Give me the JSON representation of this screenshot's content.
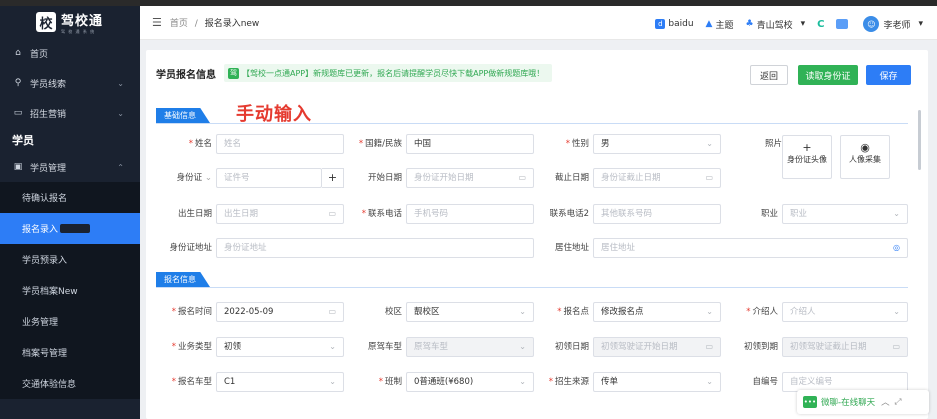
{
  "app": {
    "logo_badge": "校",
    "logo_name": "驾校通",
    "logo_sub": "驾 校 通 系 统"
  },
  "sidebar": {
    "items": [
      {
        "label": "首页",
        "icon": "home-icon",
        "glyph": "⌂"
      },
      {
        "label": "学员线索",
        "icon": "clue-icon",
        "glyph": "⚲",
        "chev": "⌄"
      },
      {
        "label": "招生营销",
        "icon": "marketing-icon",
        "glyph": "▭",
        "chev": "⌄"
      }
    ],
    "group": "学员",
    "group_item": {
      "label": "学员管理",
      "icon": "student-icon",
      "glyph": "▣",
      "chev": "⌃"
    },
    "subitems": [
      "待确认报名",
      "报名录入",
      "学员预录入",
      "学员档案New",
      "业务管理",
      "档案号管理",
      "交通体验信息"
    ]
  },
  "header": {
    "menu_glyph": "☰",
    "breadcrumb_home": "首页",
    "breadcrumb_sep": "/",
    "breadcrumb_current": "报名录入new",
    "baidu": "baidu",
    "theme": "主题",
    "school": "青山驾校",
    "school_chev": "▾",
    "user": "李老师",
    "user_chev": "▾"
  },
  "form": {
    "title": "学员报名信息",
    "notice_badge": "驾",
    "notice": "【驾校一点通APP】新规题库已更新，报名后请提醒学员尽快下载APP做新规题库哦！",
    "back": "返回",
    "read_id": "读取身份证",
    "save": "保存",
    "section_basic": "基础信息",
    "section_enroll": "报名信息",
    "annotation": "手动输入",
    "fields": {
      "name_label": "姓名",
      "name_ph": "姓名",
      "nation_label": "国籍/民族",
      "nation_val": "中国",
      "gender_label": "性别",
      "gender_val": "男",
      "photo_label": "照片",
      "idcard_photo": "身份证头像",
      "face_capture": "人像采集",
      "idtype_label": "身份证",
      "idno_ph": "证件号",
      "start_label": "开始日期",
      "start_ph": "身份证开始日期",
      "end_label": "截止日期",
      "end_ph": "身份证截止日期",
      "birth_label": "出生日期",
      "birth_ph": "出生日期",
      "phone_label": "联系电话",
      "phone_ph": "手机号码",
      "phone2_label": "联系电话2",
      "phone2_ph": "其他联系号码",
      "job_label": "职业",
      "job_ph": "职业",
      "idaddr_label": "身份证地址",
      "idaddr_ph": "身份证地址",
      "addr_label": "居住地址",
      "addr_ph": "居住地址",
      "time_label": "报名时间",
      "time_val": "2022-05-09",
      "campus_label": "校区",
      "campus_val": "靓校区",
      "point_label": "报名点",
      "point_val": "修改报名点",
      "intro_label": "介绍人",
      "intro_ph": "介绍人",
      "biz_label": "业务类型",
      "biz_val": "初领",
      "orig_label": "原驾车型",
      "orig_ph": "原驾车型",
      "first_label": "初领日期",
      "first_ph": "初领驾驶证开始日期",
      "expire_label": "初领到期",
      "expire_ph": "初领驾驶证截止日期",
      "car_label": "报名车型",
      "car_val": "C1",
      "class_label": "班制",
      "class_val": "0普通班(¥680)",
      "source_label": "招生来源",
      "source_val": "传单",
      "code_label": "自编号",
      "code_ph": "自定义编号"
    }
  },
  "chat": {
    "label": "微聊-在线聊天"
  },
  "colors": {
    "primary": "#2d7df6",
    "green": "#30b256",
    "sidebar": "#1a2230",
    "required": "#e53a2f"
  }
}
